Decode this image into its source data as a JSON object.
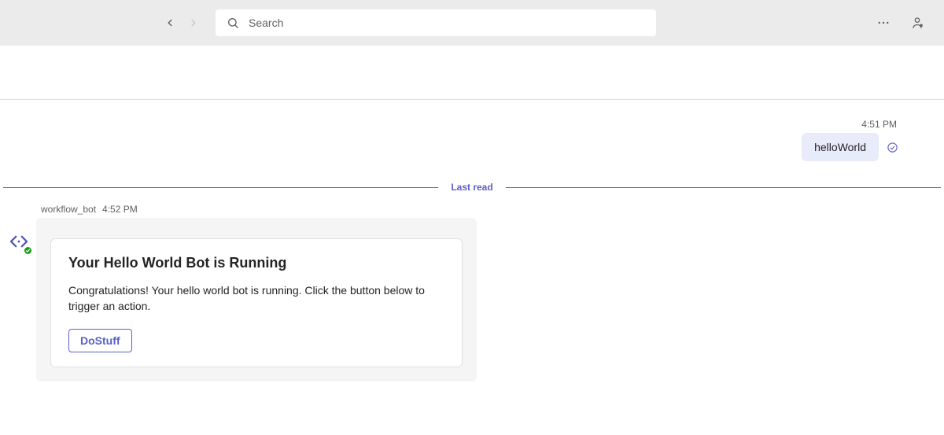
{
  "header": {
    "search_placeholder": "Search"
  },
  "outgoing": {
    "time": "4:51 PM",
    "text": "helloWorld"
  },
  "divider": {
    "label": "Last read"
  },
  "incoming": {
    "sender": "workflow_bot",
    "time": "4:52 PM",
    "card": {
      "title": "Your Hello World Bot is Running",
      "body": "Congratulations! Your hello world bot is running. Click the button below to trigger an action.",
      "action_label": "DoStuff"
    }
  }
}
